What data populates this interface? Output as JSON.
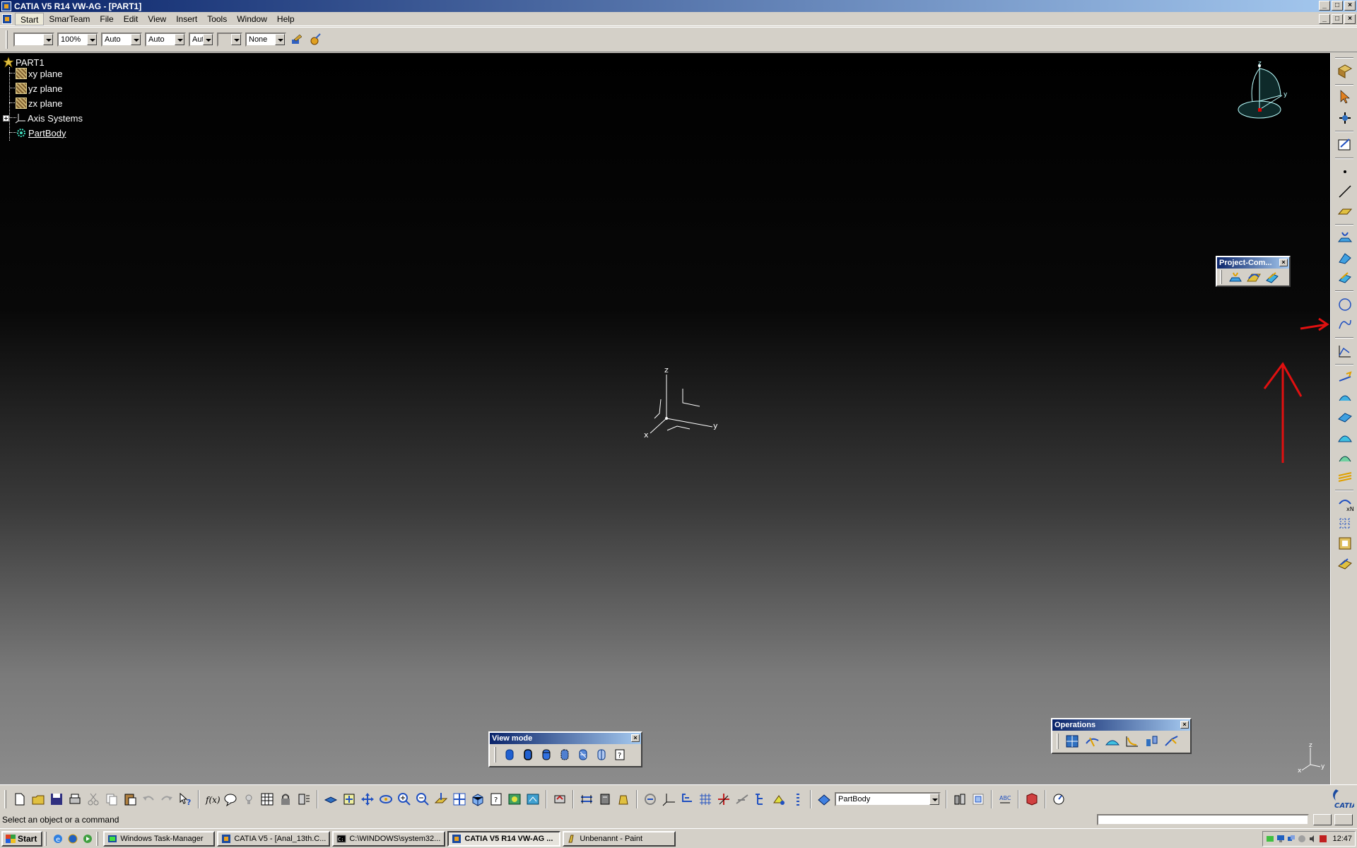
{
  "window": {
    "title": "CATIA V5 R14 VW-AG - [PART1]"
  },
  "menu": {
    "items": [
      "Start",
      "SmarTeam",
      "File",
      "Edit",
      "View",
      "Insert",
      "Tools",
      "Window",
      "Help"
    ]
  },
  "properties_toolbar": {
    "color_value": "",
    "transparency_value": "100%",
    "linetype_value": "Auto",
    "lineweight_value": "Auto",
    "pointstyle_value": "Aut",
    "layer_value": "None"
  },
  "spec_tree": {
    "root": "PART1",
    "items": [
      "xy plane",
      "yz plane",
      "zx plane",
      "Axis Systems",
      "PartBody"
    ]
  },
  "axis_labels": {
    "x": "x",
    "y": "y",
    "z": "z"
  },
  "floating_toolbars": {
    "project": {
      "title": "Project-Com..."
    },
    "view_mode": {
      "title": "View mode"
    },
    "operations": {
      "title": "Operations"
    }
  },
  "bottom_toolbar": {
    "current_body": "PartBody"
  },
  "status_bar": {
    "message": "Select an object or a command"
  },
  "taskbar": {
    "start_label": "Start",
    "tasks": [
      "Windows Task-Manager",
      "CATIA V5 - [Anal_13th.C...",
      "C:\\WINDOWS\\system32...",
      "CATIA V5 R14 VW-AG ...",
      "Unbenannt - Paint"
    ],
    "clock": "12:47"
  },
  "annotation_color": "#e01010",
  "accent_color": "#0a246a"
}
